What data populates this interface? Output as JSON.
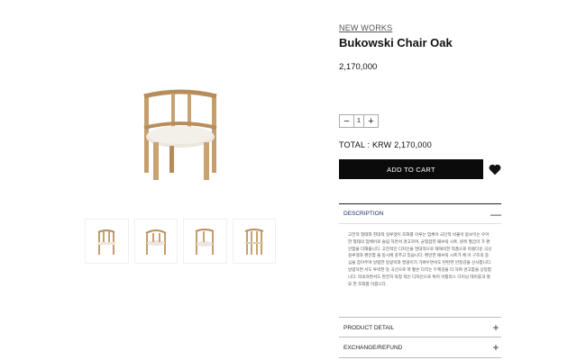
{
  "product": {
    "brand": "NEW WORKS",
    "title": "Bukowski Chair Oak",
    "price": "2,170,000"
  },
  "quantity": {
    "value": "1",
    "minus": "−",
    "plus": "+"
  },
  "total": "TOTAL : KRW 2,170,000",
  "cart_label": "ADD TO CART",
  "accordions": {
    "description": {
      "label": "DESCRIPTION",
      "toggle": "—",
      "text": "고전적 형태와 현대적 실루엣이 조화를 이루는 엄체어 극단적 비율이 돋보이는 우아한 형태의 엄체어로 슬림 하면서 견고하며, 균형잡힌 패브릭 시트, 원목 월굽이 가 편안함을 더해줍니다. 고전적인 디자인을 현대적으로 재해석한 작품으로 아름다운 곡선 실루엣과 편안함 을 동시에 갖추고 있습니다. 편안한 패브릭 시트가 체 어 구조의 중심을 잡아주며 날렵한 등받이와 팔걸이가 가벼우면서도 탄탄한 안정감을 선사합니다. 날렵하면 서도 투박한 듯 곡선으로 쭉 뻗은 다리는 두께감을 더 하여 견고함을 상징합니다. 익숙하면서도 완전히 독창 적인 디자인으로 특히 아틀라스 다이닝 테이블과 절묘 한 조화를 이룹니다."
    },
    "product_detail": {
      "label": "PRODUCT DETAIL",
      "toggle": "+"
    },
    "exchange_refund": {
      "label": "EXCHANGE/REFUND",
      "toggle": "+"
    }
  },
  "colors": {
    "wood": "#c9a272",
    "wood_dark": "#a77f52",
    "seat": "#e9e5dc",
    "accent": "#1a2f6b"
  },
  "icons": [
    "heart-icon",
    "plus-icon",
    "minus-icon"
  ]
}
